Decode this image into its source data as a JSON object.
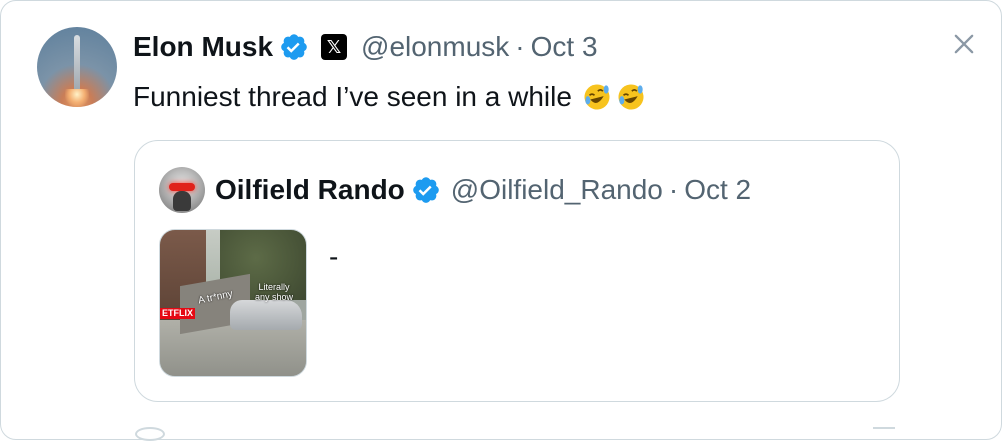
{
  "tweet": {
    "author_name": "Elon Musk",
    "author_handle": "@elonmusk",
    "separator": "·",
    "date": "Oct 3",
    "text": "Funniest thread I’ve seen in a while",
    "emojis": [
      "rolling-on-floor-laughing",
      "rolling-on-floor-laughing"
    ],
    "affiliation_badge": "𝕏"
  },
  "quoted_tweet": {
    "author_name": "Oilfield Rando",
    "author_handle": "@Oilfield_Rando",
    "separator": "·",
    "date": "Oct 2",
    "text": "-",
    "media": {
      "caption_left": "A tr*nny",
      "caption_right": "Literally any show",
      "brand": "ETFLIX"
    }
  },
  "colors": {
    "verified_blue": "#1d9bf0",
    "text_primary": "#0f1419",
    "text_secondary": "#536471",
    "border": "#cfd9de"
  },
  "icons": {
    "close": "close-icon",
    "verified": "verified-badge-icon"
  }
}
